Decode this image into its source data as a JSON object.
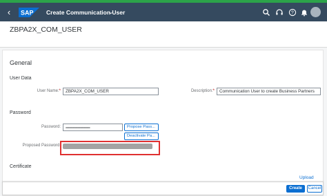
{
  "shell": {
    "top_banner": "",
    "app_title": "Create Communication User",
    "logo_text": "SAP",
    "avatar_initial": "",
    "icons": [
      "back-icon",
      "sap-logo",
      "chevron-down-icon",
      "search-icon",
      "headset-icon",
      "help-icon",
      "bell-icon",
      "avatar"
    ]
  },
  "header": {
    "title": "ZBPA2X_COM_USER"
  },
  "general": {
    "title": "General",
    "user_data": {
      "title": "User Data",
      "user_name_label": "User Name:",
      "user_name_required": "*",
      "user_name_value": "ZBPA2X_COM_USER",
      "description_label": "Description:",
      "description_required": "*",
      "description_value": "Communication User to create Business Partners"
    },
    "password": {
      "title": "Password",
      "password_label": "Password:",
      "password_value": "••••••••••••••••••••••••••••••••••••••••••••",
      "propose_button": "Propose Pass...",
      "deactivate_button": "Deactivate Pa...",
      "proposed_label": "Proposed Password:"
    },
    "certificate": {
      "title": "Certificate",
      "upload_link": "Upload"
    }
  },
  "footer": {
    "create_label": "Create",
    "cancel_label": "Cancel"
  },
  "colors": {
    "shell": "#354a5f",
    "accent": "#0a6ed1",
    "highlight": "#e03030",
    "banner": "#2ca34a"
  }
}
